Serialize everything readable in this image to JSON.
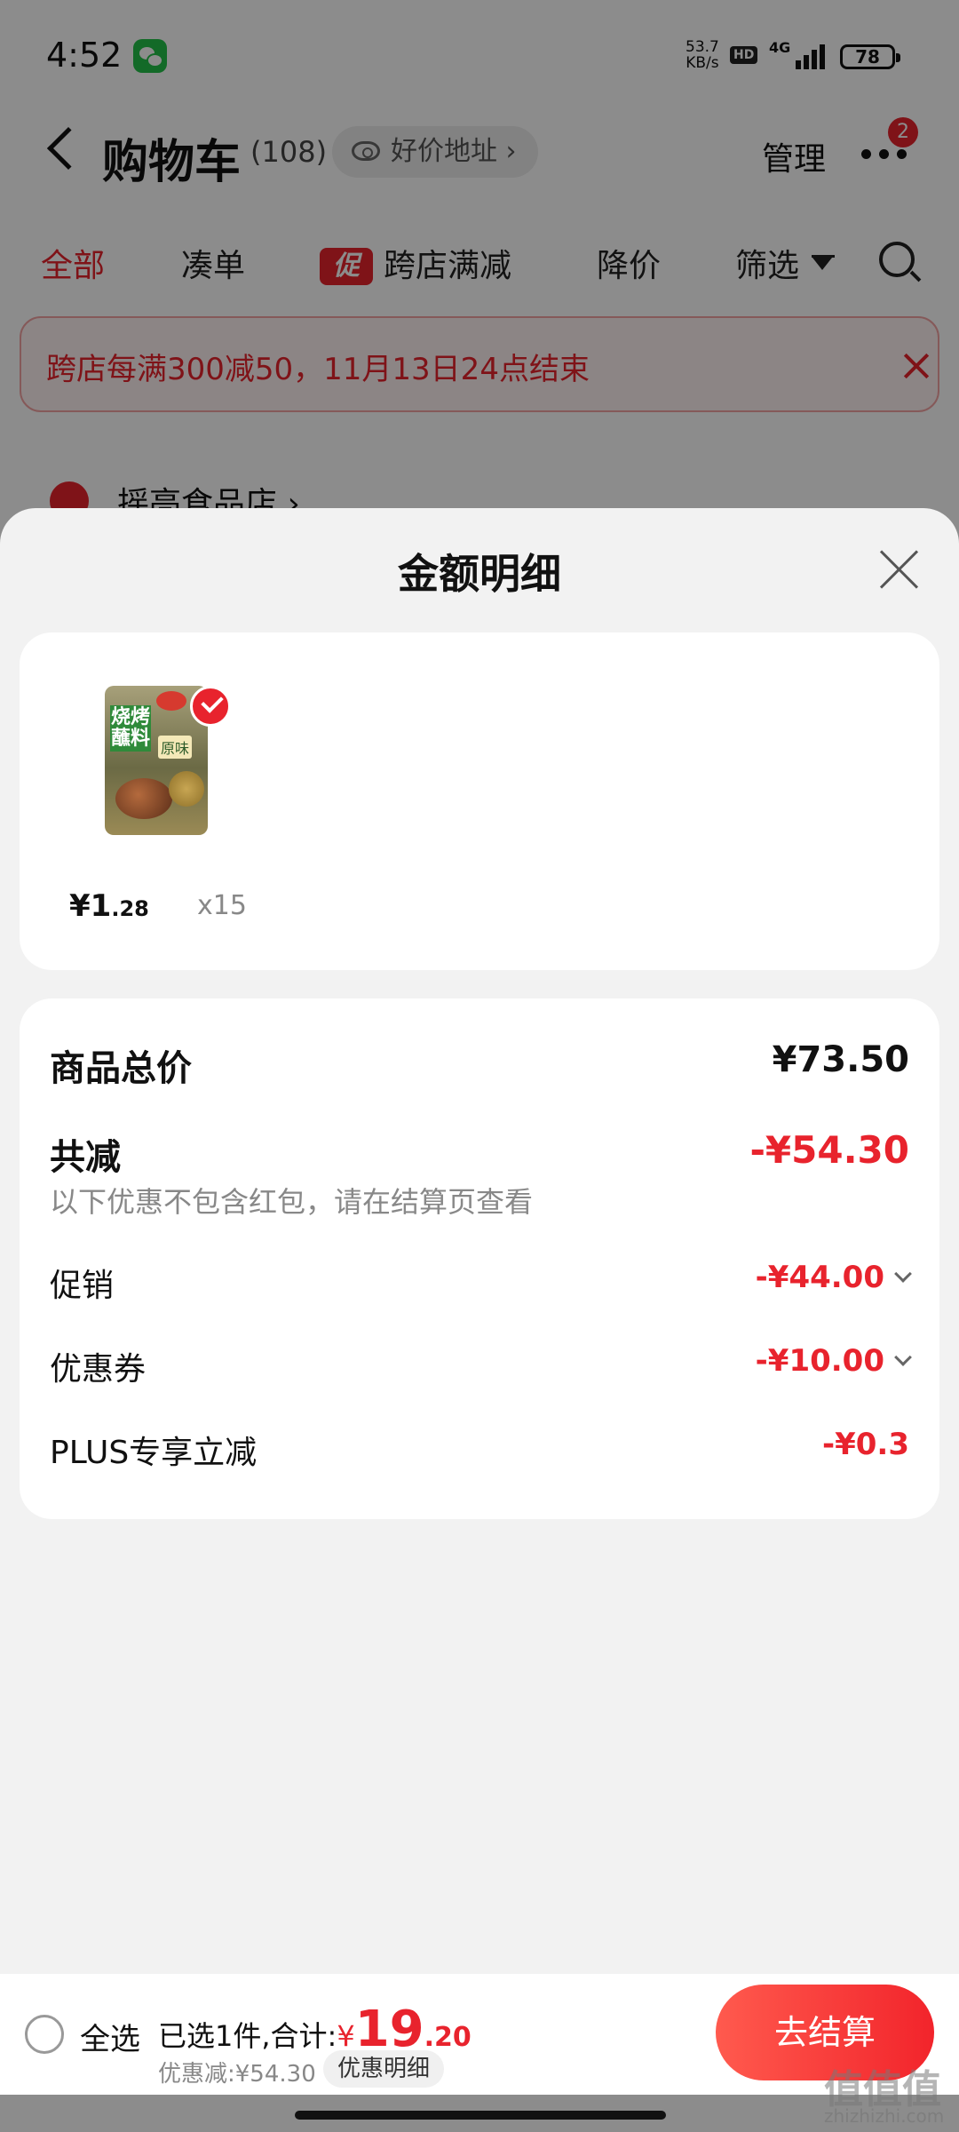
{
  "status_bar": {
    "time": "4:52",
    "net_speed_value": "53.7",
    "net_speed_unit": "KB/s",
    "hd": "HD",
    "network": "4G",
    "battery": "78"
  },
  "header": {
    "title": "购物车",
    "count": "(108)",
    "address_label": "好价地址 ›",
    "manage": "管理",
    "badge_count": "2"
  },
  "tabs": [
    {
      "label": "全部",
      "active": true
    },
    {
      "label": "凑单"
    },
    {
      "label": "跨店满减",
      "tag": "促"
    },
    {
      "label": "降价"
    },
    {
      "label": "筛选"
    }
  ],
  "promo_banner": {
    "text": "跨店每满300减50，11月13日24点结束"
  },
  "store": {
    "name": "摇亮食品店 ›"
  },
  "sheet": {
    "title": "金额明细",
    "product": {
      "price_int": "¥1",
      "price_dec": ".28",
      "quantity": "x15",
      "image_label": "烧烤蘸料",
      "image_flavor": "原味"
    },
    "summary": {
      "total_label": "商品总价",
      "total_value": "¥73.50",
      "discount_label": "共减",
      "discount_value": "-¥54.30",
      "note": "以下优惠不包含红包，请在结算页查看",
      "promotion_label": "促销",
      "promotion_value": "-¥44.00",
      "coupon_label": "优惠券",
      "coupon_value": "-¥10.00",
      "plus_label": "PLUS专享立减",
      "plus_value": "-¥0.3"
    }
  },
  "bottom_bar": {
    "select_all": "全选",
    "selected_text": "已选1件,合计:",
    "total_yen": "¥",
    "total_int": "19",
    "total_dec": ".20",
    "discount_text": "优惠减:¥54.30",
    "detail_button": "优惠明细",
    "checkout": "去结算"
  },
  "watermark": {
    "text": "值值值",
    "sub": "zhizhizhi.com"
  },
  "colors": {
    "accent": "#e8232d",
    "sheet_background": "#f2f2f2"
  }
}
